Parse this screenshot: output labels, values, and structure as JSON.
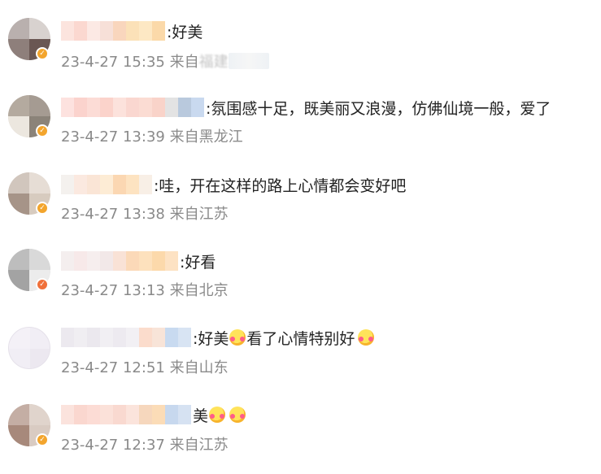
{
  "comments": [
    {
      "text": ":好美",
      "emojis": 0,
      "meta": "23-4-27 15:35 来自",
      "location": "福建",
      "badge": "gold"
    },
    {
      "text": ":氛围感十足，既美丽又浪漫，仿佛仙境一般，爱了",
      "emojis": 0,
      "meta": "23-4-27 13:39 来自",
      "location": "黑龙江",
      "badge": "gold"
    },
    {
      "text": ":哇，开在这样的路上心情都会变好吧",
      "emojis": 0,
      "meta": "23-4-27 13:38 来自",
      "location": "江苏",
      "badge": "gold"
    },
    {
      "text": ":好看",
      "emojis": 0,
      "meta": "23-4-27 13:13 来自",
      "location": "北京",
      "badge": "orange"
    },
    {
      "text_a": ":好美",
      "text_b": "看了心情特别好",
      "meta": "23-4-27 12:51 来自",
      "location": "山东",
      "badge": "none"
    },
    {
      "text": "美",
      "emojis": 2,
      "meta": "23-4-27 12:37 来自",
      "location": "江苏",
      "badge": "gold"
    }
  ],
  "colors": {
    "accent_badge_gold": "#f3a52d",
    "accent_badge_orange": "#f0703a",
    "meta_gray": "#8a8a8a"
  }
}
